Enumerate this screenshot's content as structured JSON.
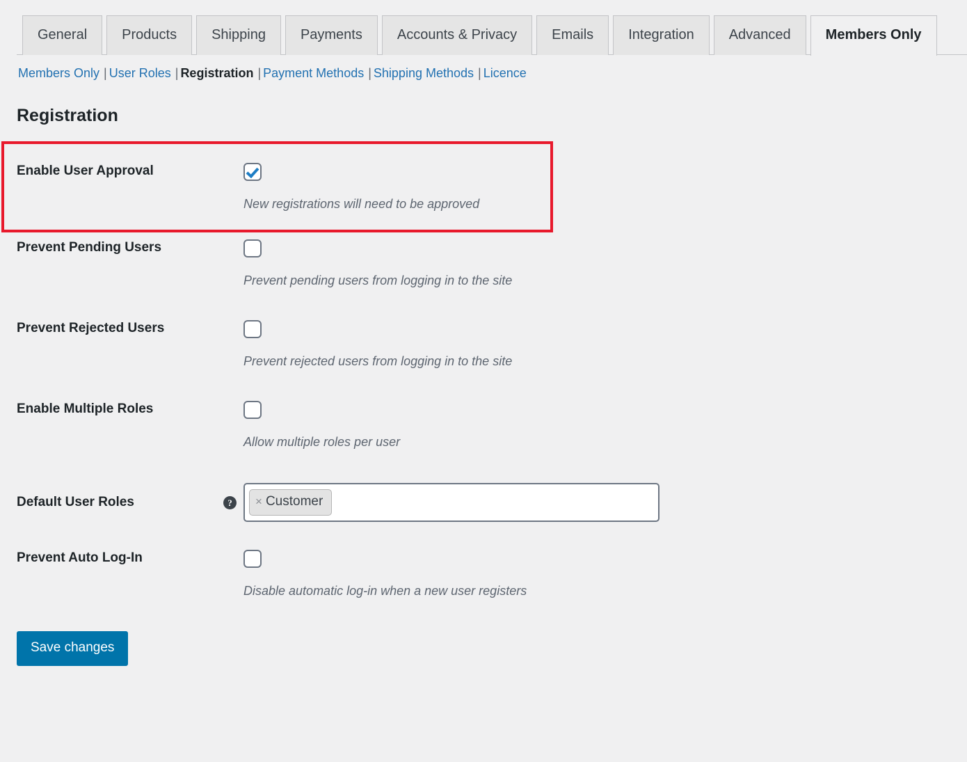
{
  "tabs": [
    {
      "label": "General",
      "active": false
    },
    {
      "label": "Products",
      "active": false
    },
    {
      "label": "Shipping",
      "active": false
    },
    {
      "label": "Payments",
      "active": false
    },
    {
      "label": "Accounts & Privacy",
      "active": false
    },
    {
      "label": "Emails",
      "active": false
    },
    {
      "label": "Integration",
      "active": false
    },
    {
      "label": "Advanced",
      "active": false
    },
    {
      "label": "Members Only",
      "active": true
    }
  ],
  "subnav": [
    {
      "label": "Members Only",
      "current": false
    },
    {
      "label": "User Roles",
      "current": false
    },
    {
      "label": "Registration",
      "current": true
    },
    {
      "label": "Payment Methods",
      "current": false
    },
    {
      "label": "Shipping Methods",
      "current": false
    },
    {
      "label": "Licence",
      "current": false
    }
  ],
  "subnav_separator": "|",
  "page": {
    "title": "Registration"
  },
  "rows": [
    {
      "label": "Enable User Approval",
      "control": "checkbox",
      "checked": true,
      "description": "New registrations will need to be approved",
      "highlighted": true
    },
    {
      "label": "Prevent Pending Users",
      "control": "checkbox",
      "checked": false,
      "description": "Prevent pending users from logging in to the site",
      "highlighted": false
    },
    {
      "label": "Prevent Rejected Users",
      "control": "checkbox",
      "checked": false,
      "description": "Prevent rejected users from logging in to the site",
      "highlighted": false
    },
    {
      "label": "Enable Multiple Roles",
      "control": "checkbox",
      "checked": false,
      "description": "Allow multiple roles per user",
      "highlighted": false
    },
    {
      "label": "Default User Roles",
      "control": "tags",
      "help": "?",
      "tags": [
        {
          "label": "Customer",
          "remove": "×"
        }
      ],
      "description": "",
      "highlighted": false
    },
    {
      "label": "Prevent Auto Log-In",
      "control": "checkbox",
      "checked": false,
      "description": "Disable automatic log-in when a new user registers",
      "highlighted": false
    }
  ],
  "footer": {
    "save_label": "Save changes"
  },
  "colors": {
    "page_background": "#f0f0f1",
    "accent_blue": "#0074aa",
    "link_blue": "#2271b1",
    "highlight_red": "#e8192c",
    "checkmark_blue": "#1d7dc4",
    "tab_inactive": "#e5e5e5"
  }
}
